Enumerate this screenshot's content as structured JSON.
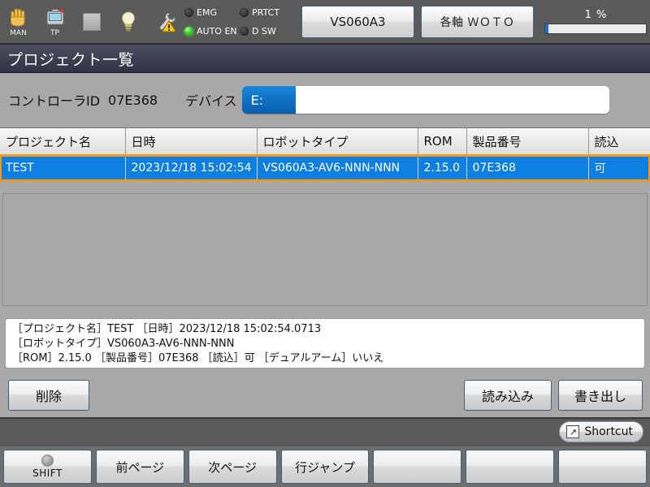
{
  "topbar": {
    "icons": [
      {
        "name": "hand-manual-icon",
        "caption": "MAN"
      },
      {
        "name": "teach-pendant-icon",
        "caption": "TP"
      },
      {
        "name": "stop-square-icon",
        "caption": ""
      },
      {
        "name": "lamp-icon",
        "caption": ""
      },
      {
        "name": "wrench-warning-icon",
        "caption": ""
      }
    ],
    "leds": [
      {
        "label": "EMG",
        "on": false
      },
      {
        "label": "PRTCT",
        "on": false
      },
      {
        "label": "AUTO EN",
        "on": true
      },
      {
        "label": "D SW",
        "on": false
      }
    ],
    "model_button": "VS060A3",
    "axis_button": "各軸 ＷＯＴＯ",
    "progress_text": "1 %",
    "progress_percent": 1
  },
  "title": "プロジェクト一覧",
  "info": {
    "controller_id_label": "コントローラID",
    "controller_id_value": "07E368",
    "device_label": "デバイス",
    "device_tag": "E:",
    "device_path": ""
  },
  "table": {
    "columns": [
      "プロジェクト名",
      "日時",
      "ロボットタイプ",
      "ROM",
      "製品番号",
      "読込"
    ],
    "rows": [
      {
        "project": "TEST",
        "datetime": "2023/12/18 15:02:54",
        "robot_type": "VS060A3-AV6-NNN-NNN",
        "rom": "2.15.0",
        "serial": "07E368",
        "readable": "可",
        "selected": true
      }
    ]
  },
  "detail": {
    "line1": "［プロジェクト名］TEST ［日時］2023/12/18 15:02:54.0713",
    "line2": "［ロボットタイプ］VS060A3-AV6-NNN-NNN",
    "line3": "［ROM］2.15.0 ［製品番号］07E368 ［読込］可 ［デュアルアーム］いいえ"
  },
  "actions": {
    "delete": "削除",
    "import": "読み込み",
    "export": "書き出し"
  },
  "shortcut": {
    "label": "Shortcut",
    "icon": "↗"
  },
  "fkeys": [
    {
      "label": "SHIFT",
      "type": "shift"
    },
    {
      "label": "前ページ",
      "type": "text"
    },
    {
      "label": "次ページ",
      "type": "text"
    },
    {
      "label": "行ジャンプ",
      "type": "text"
    },
    {
      "label": "",
      "type": "text"
    },
    {
      "label": "",
      "type": "text"
    },
    {
      "label": "",
      "type": "text"
    }
  ],
  "colors": {
    "selection_blue": "#0d7fe0",
    "selection_outline": "#f59a1a",
    "device_tag_blue": "#1183d2",
    "led_green": "#39d42a",
    "progress_blue": "#1273d4"
  }
}
